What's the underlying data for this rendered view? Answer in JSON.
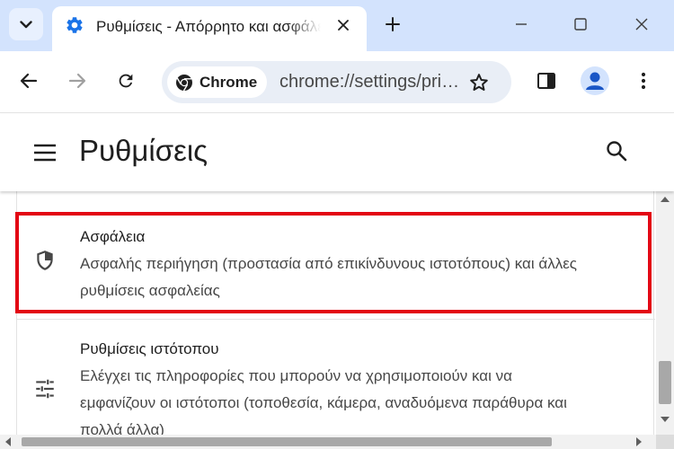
{
  "browser": {
    "tab": {
      "title": "Ρυθμίσεις - Απόρρητο και ασφάλεια",
      "icon": "gear-icon"
    },
    "omnibox": {
      "chip_label": "Chrome",
      "url": "chrome://settings/privacy"
    },
    "accent_color": "#1a73e8"
  },
  "settings": {
    "title": "Ρυθμίσεις",
    "rows": [
      {
        "icon": "shield-icon",
        "title": "Ασφάλεια",
        "description_line1": "Ασφαλής περιήγηση (προστασία από επικίνδυνους ιστοτόπους) και άλλες",
        "description_line2": "ρυθμίσεις ασφαλείας"
      },
      {
        "icon": "tune-sliders-icon",
        "title": "Ρυθμίσεις ιστότοπου",
        "description_line1": "Ελέγχει τις πληροφορίες που μπορούν να χρησιμοποιούν και να",
        "description_line2": "εμφανίζουν οι ιστότοποι (τοποθεσία, κάμερα, αναδυόμενα παράθυρα και",
        "description_line3": "πολλά άλλα)"
      }
    ],
    "highlight_color": "#e30613"
  }
}
